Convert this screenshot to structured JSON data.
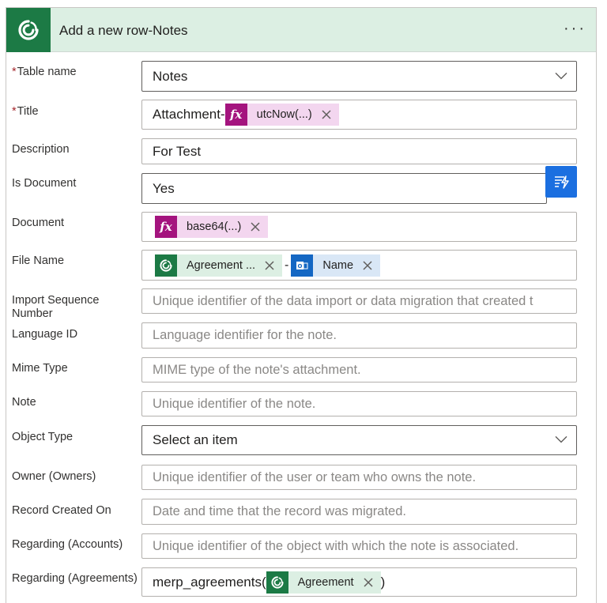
{
  "header": {
    "title": "Add a new row-Notes",
    "menu_label": "···",
    "icon": "dataverse-icon"
  },
  "fields": {
    "table_name": {
      "label": "Table name",
      "required": "*",
      "value": "Notes"
    },
    "title": {
      "label": "Title",
      "required": "*",
      "prefix": "Attachment-",
      "token": {
        "icon": "fx-icon",
        "text": "utcNow(...)"
      }
    },
    "description": {
      "label": "Description",
      "value": "For Test"
    },
    "is_document": {
      "label": "Is Document",
      "value": "Yes"
    },
    "document": {
      "label": "Document",
      "token": {
        "icon": "fx-icon",
        "text": "base64(...)"
      }
    },
    "file_name": {
      "label": "File Name",
      "token1": {
        "icon": "dataverse-icon",
        "text": "Agreement ..."
      },
      "separator": "-",
      "token2": {
        "icon": "outlook-icon",
        "text": "Name"
      }
    },
    "import_sequence_number": {
      "label_line1": "Import Sequence",
      "label_line2": "Number",
      "placeholder": "Unique identifier of the data import or data migration that created t"
    },
    "language_id": {
      "label": "Language ID",
      "placeholder": "Language identifier for the note."
    },
    "mime_type": {
      "label": "Mime Type",
      "placeholder": "MIME type of the note's attachment."
    },
    "note": {
      "label": "Note",
      "placeholder": "Unique identifier of the note."
    },
    "object_type": {
      "label": "Object Type",
      "value": "Select an item"
    },
    "owner": {
      "label": "Owner (Owners)",
      "placeholder": "Unique identifier of the user or team who owns the note."
    },
    "record_created_on": {
      "label": "Record Created On",
      "placeholder": "Date and time that the record was migrated."
    },
    "regarding_accounts": {
      "label": "Regarding (Accounts)",
      "placeholder": "Unique identifier of the object with which the note is associated."
    },
    "regarding_agreements": {
      "label": "Regarding (Agreements)",
      "prefix": "merp_agreements(",
      "token": {
        "icon": "dataverse-icon",
        "text": "Agreement"
      },
      "suffix": ")"
    }
  },
  "colors": {
    "header_bg": "#dcefe3",
    "dataverse_green": "#1c7a45",
    "fx_magenta": "#a4147e",
    "fx_token_bg": "#f3d6ef",
    "outlook_blue": "#1467c3",
    "dynamic_button_blue": "#1b6fe0",
    "required_red": "#a4262c"
  }
}
